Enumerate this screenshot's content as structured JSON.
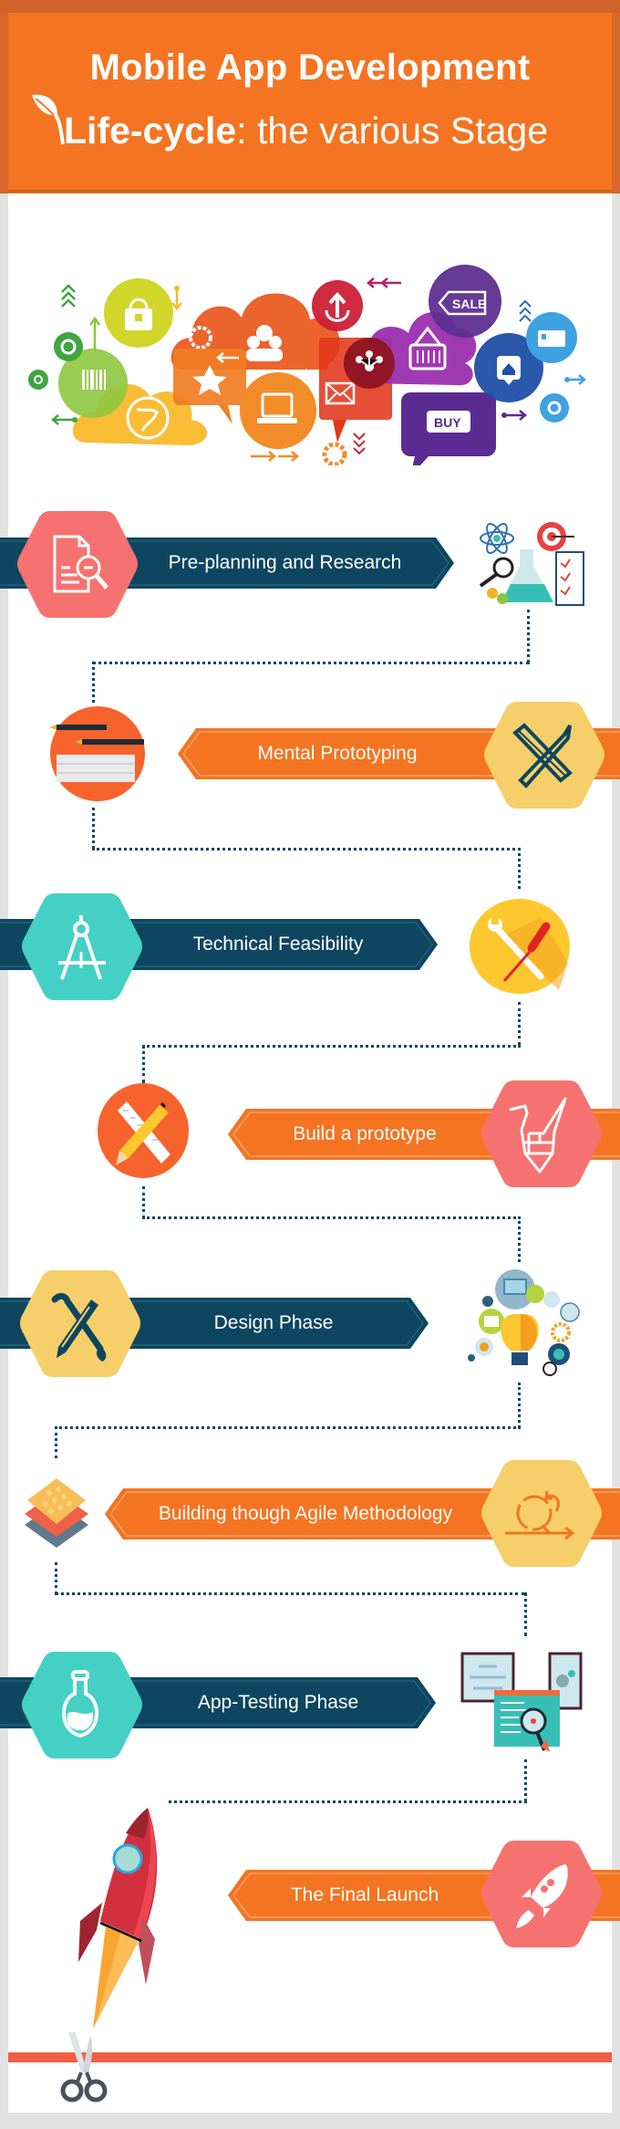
{
  "header": {
    "title_line1": "Mobile App Development",
    "title_line2_bold": "Life-cycle",
    "title_line2_rest": ": the various Stage",
    "icon": "leaf-icon"
  },
  "colors": {
    "header_orange": "#f47421",
    "ribbon_dark": "#0e4660",
    "ribbon_orange": "#f47421",
    "hex_coral": "#f67270",
    "hex_teal": "#45d0c5",
    "hex_yellow": "#f6cf6a",
    "finish_line": "#f05f45"
  },
  "illustration": {
    "description": "Colorful cloud of app commerce icons",
    "icons": [
      "shopping-bag-icon",
      "barcode-icon",
      "globe-icon",
      "gear-icon",
      "people-chat-icon",
      "star-icon",
      "laptop-icon",
      "upload-icon",
      "mail-icon",
      "share-icon",
      "basket-icon",
      "sale-tag-icon",
      "buy-button-icon",
      "home-pin-icon",
      "credit-card-icon"
    ],
    "sale_label": "SALE",
    "buy_label": "BUY"
  },
  "stages": [
    {
      "label": "Pre-planning and Research",
      "hex_icon": "document-search-icon",
      "side_icon": "research-lab-icon"
    },
    {
      "label": "Mental Prototyping",
      "hex_icon": "ruler-pencil-icon",
      "side_icon": "keyboard-pencils-icon"
    },
    {
      "label": "Technical Feasibility",
      "hex_icon": "compass-icon",
      "side_icon": "wrench-screwdriver-icon"
    },
    {
      "label": "Build a prototype",
      "hex_icon": "origami-crane-icon",
      "side_icon": "pencil-ruler-icon"
    },
    {
      "label": "Design Phase",
      "hex_icon": "pencil-brush-icon",
      "side_icon": "lightbulb-gears-icon"
    },
    {
      "label": "Building though Agile Methodology",
      "hex_icon": "agile-cycle-icon",
      "side_icon": "layers-icon"
    },
    {
      "label": "App-Testing Phase",
      "hex_icon": "flask-icon",
      "side_icon": "testing-screens-icon"
    },
    {
      "label": "The Final Launch",
      "hex_icon": "rocket-icon",
      "side_icon": "rocket-launch-icon"
    }
  ],
  "footer": {
    "icon": "scissors-icon"
  }
}
